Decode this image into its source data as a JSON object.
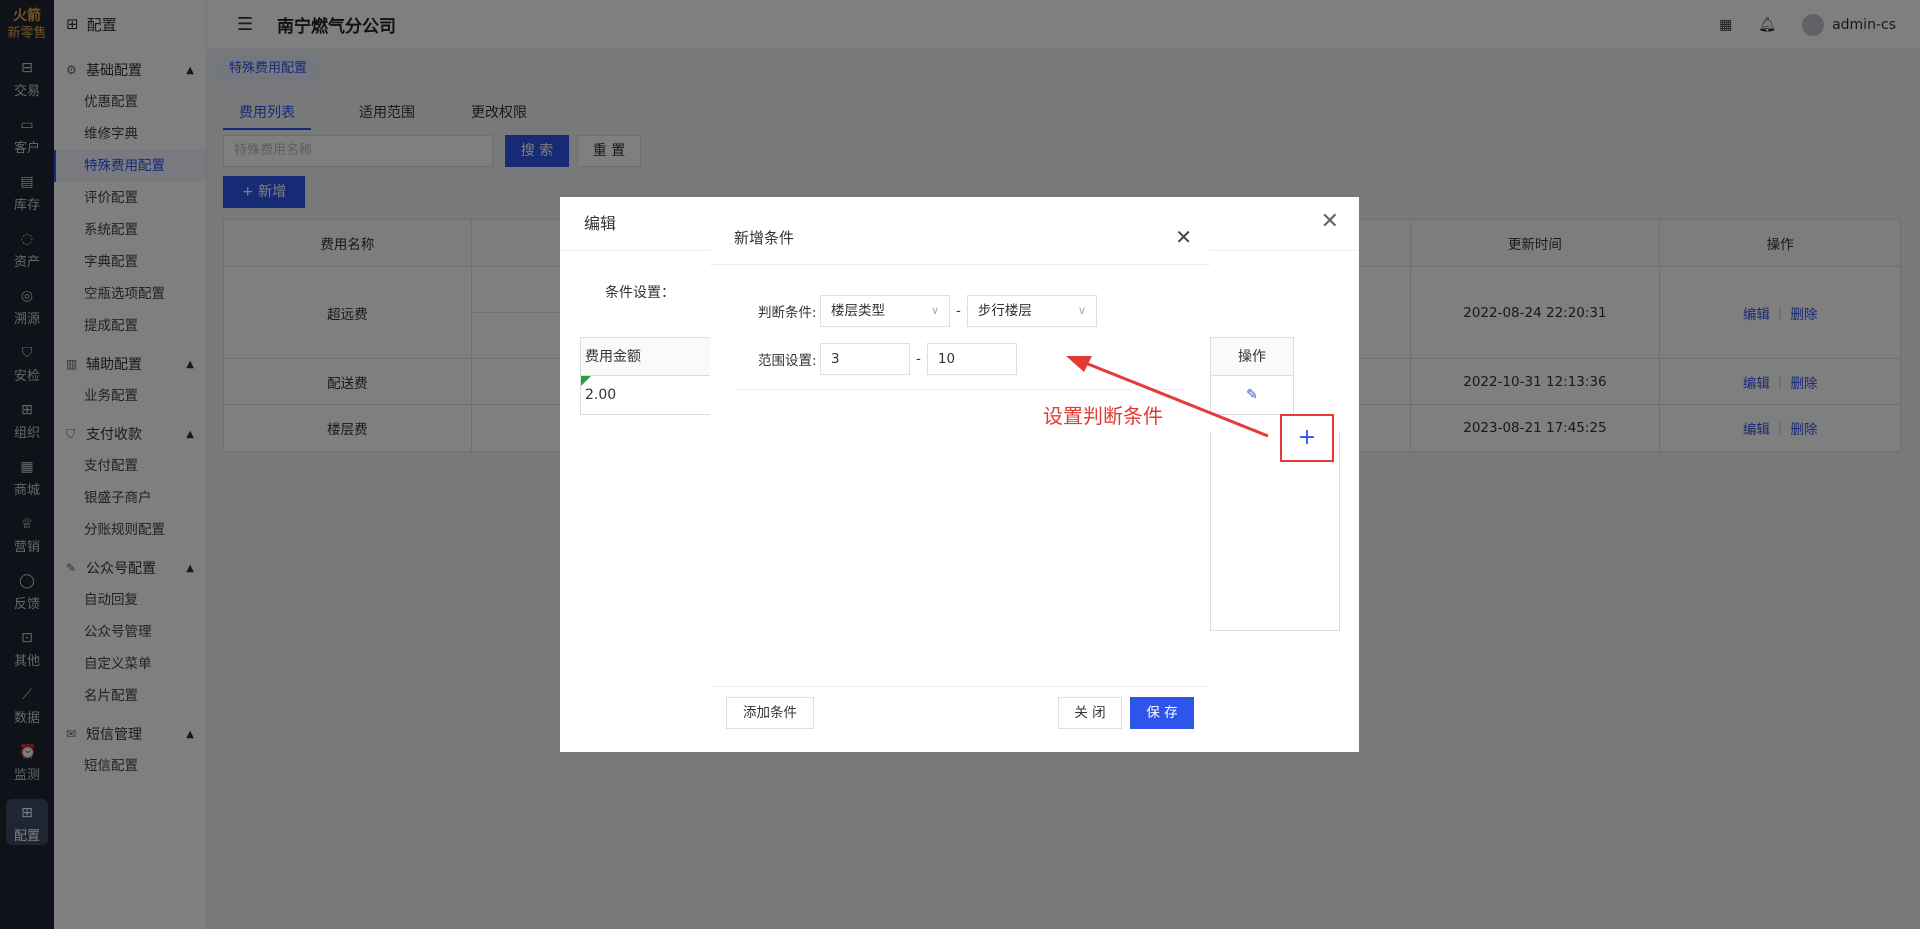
{
  "rail": {
    "logo_top": "火箭",
    "logo_bottom": "新零售",
    "items": [
      {
        "label": "交易",
        "icon": "bag-icon"
      },
      {
        "label": "客户",
        "icon": "id-card-icon"
      },
      {
        "label": "库存",
        "icon": "inventory-icon"
      },
      {
        "label": "资产",
        "icon": "bulb-icon"
      },
      {
        "label": "溯源",
        "icon": "compass-icon"
      },
      {
        "label": "安检",
        "icon": "shield-icon"
      },
      {
        "label": "组织",
        "icon": "org-icon"
      },
      {
        "label": "商城",
        "icon": "store-icon"
      },
      {
        "label": "营销",
        "icon": "trophy-icon"
      },
      {
        "label": "反馈",
        "icon": "chat-icon"
      },
      {
        "label": "其他",
        "icon": "other-icon"
      },
      {
        "label": "数据",
        "icon": "chart-icon"
      },
      {
        "label": "监测",
        "icon": "alarm-icon"
      },
      {
        "label": "配置",
        "icon": "grid-icon"
      }
    ]
  },
  "sidebar": {
    "title": "配置",
    "groups": [
      {
        "label": "基础配置",
        "items": [
          "优惠配置",
          "维修字典",
          "特殊费用配置",
          "评价配置",
          "系统配置",
          "字典配置",
          "空瓶选项配置",
          "提成配置"
        ]
      },
      {
        "label": "辅助配置",
        "items": [
          "业务配置"
        ]
      },
      {
        "label": "支付收款",
        "items": [
          "支付配置",
          "银盛子商户",
          "分账规则配置"
        ]
      },
      {
        "label": "公众号配置",
        "items": [
          "自动回复",
          "公众号管理",
          "自定义菜单",
          "名片配置"
        ]
      },
      {
        "label": "短信管理",
        "items": [
          "短信配置"
        ]
      }
    ]
  },
  "header": {
    "company": "南宁燃气分公司",
    "user": "admin-cs"
  },
  "breadcrumb": "特殊费用配置",
  "tabs": [
    "费用列表",
    "适用范围",
    "更改权限"
  ],
  "search": {
    "placeholder": "特殊费用名称",
    "search_label": "搜 索",
    "reset_label": "重 置",
    "add_label": "+ 新增"
  },
  "table": {
    "headers": [
      "费用名称",
      "",
      "更新时间",
      "操作"
    ],
    "rows": [
      {
        "name": "超远费",
        "time": "2022-08-24 22:20:31"
      },
      {
        "name": "配送费",
        "time": "2022-10-31 12:13:36"
      },
      {
        "name": "楼层费",
        "time": "2023-08-21 17:45:25"
      }
    ],
    "edit_label": "编辑",
    "delete_label": "删除"
  },
  "edit_dialog": {
    "title": "编辑",
    "condition_label": "条件设置：",
    "col_amount": "费用金额",
    "amount_value": "2.00",
    "col_op": "操作",
    "plus": "+"
  },
  "new_condition_dialog": {
    "title": "新增条件",
    "judge_label": "判断条件:",
    "judge_select1": "楼层类型",
    "judge_select2": "步行楼层",
    "range_label": "范围设置:",
    "range_from": "3",
    "range_to": "10",
    "add_condition_label": "添加条件",
    "close_label": "关 闭",
    "save_label": "保 存"
  },
  "annotation": "设置判断条件"
}
